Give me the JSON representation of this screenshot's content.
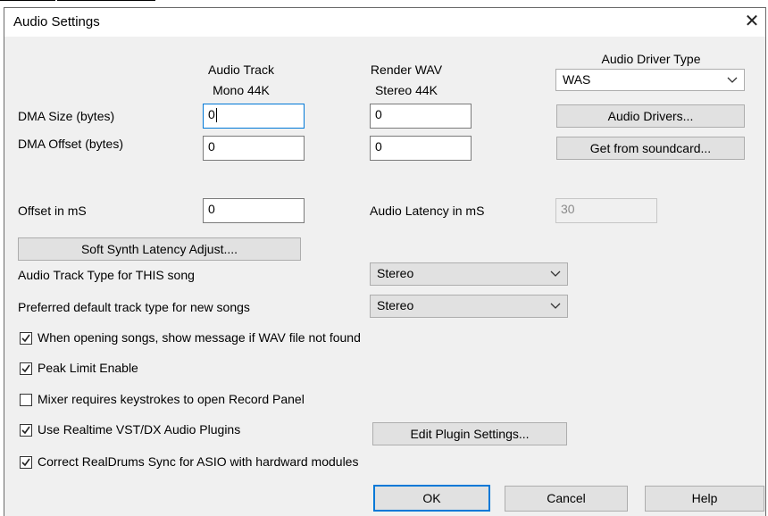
{
  "window": {
    "title": "Audio Settings"
  },
  "columns": {
    "audio_track": {
      "line1": "Audio Track",
      "line2": "Mono 44K"
    },
    "render_wav": {
      "line1": "Render WAV",
      "line2": "Stereo 44K"
    },
    "driver_type": {
      "label": "Audio Driver Type",
      "selected": "WAS"
    }
  },
  "dma_size": {
    "label": "DMA Size (bytes)",
    "audio_track": "0",
    "render_wav": "0"
  },
  "dma_offset": {
    "label": "DMA Offset (bytes)",
    "audio_track": "0",
    "render_wav": "0"
  },
  "buttons": {
    "audio_drivers": "Audio Drivers...",
    "get_from_soundcard": "Get from soundcard...",
    "soft_synth": "Soft Synth Latency Adjust....",
    "edit_plugin": "Edit Plugin Settings...",
    "ok": "OK",
    "cancel": "Cancel",
    "help": "Help"
  },
  "offset_ms": {
    "label": "Offset in mS",
    "value": "0"
  },
  "audio_latency": {
    "label": "Audio Latency in mS",
    "value": "30"
  },
  "track_type_this": {
    "label": "Audio Track Type for THIS song",
    "selected": "Stereo"
  },
  "track_type_default": {
    "label": "Preferred default track type for new songs",
    "selected": "Stereo"
  },
  "checkboxes": [
    {
      "label": "When opening songs, show message if WAV file not found",
      "checked": true
    },
    {
      "label": "Peak Limit Enable",
      "checked": true
    },
    {
      "label": "Mixer requires keystrokes to open Record Panel",
      "checked": false
    },
    {
      "label": "Use Realtime VST/DX Audio Plugins",
      "checked": true
    },
    {
      "label": "Correct RealDrums Sync for ASIO with hardward modules",
      "checked": true
    }
  ],
  "icons": {
    "close": "close-icon",
    "dropdown": "chevron-down-icon",
    "check": "checkmark-icon"
  }
}
